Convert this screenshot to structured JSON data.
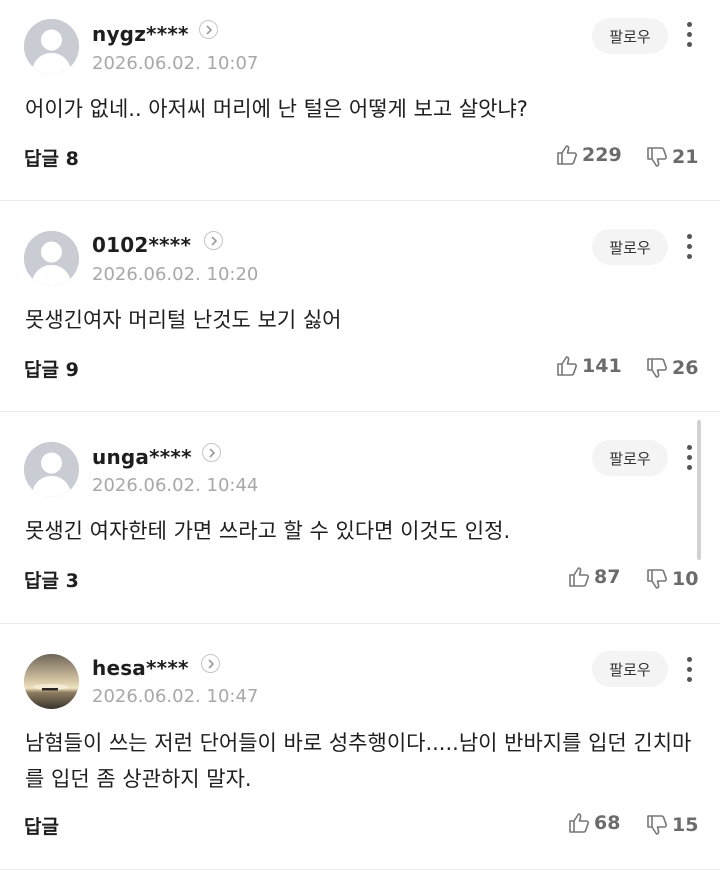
{
  "follow_label": "팔로우",
  "comments": [
    {
      "username": "nygz****",
      "timestamp": "2026.06.02. 10:07",
      "content": "어이가 없네.. 아저씨 머리에 난 털은 어떻게 보고 살앗냐?",
      "reply_label": "답글 8",
      "likes": "229",
      "dislikes": "21",
      "avatar": "default-avatar"
    },
    {
      "username": "0102****",
      "timestamp": "2026.06.02. 10:20",
      "content": "못생긴여자 머리털 난것도 보기 싫어",
      "reply_label": "답글 9",
      "likes": "141",
      "dislikes": "26",
      "avatar": "default-avatar"
    },
    {
      "username": "unga****",
      "timestamp": "2026.06.02. 10:44",
      "content": "못생긴 여자한테 가면 쓰라고 할 수 있다면 이것도 인정.",
      "reply_label": "답글 3",
      "likes": "87",
      "dislikes": "10",
      "avatar": "default-avatar"
    },
    {
      "username": "hesa****",
      "timestamp": "2026.06.02. 10:47",
      "content": "남혐들이 쓰는 저런 단어들이 바로 성추행이다.....남이 반바지를 입던 긴치마를 입던 좀 상관하지 말자.",
      "reply_label": "답글",
      "likes": "68",
      "dislikes": "15",
      "avatar": "sunset-photo-avatar"
    }
  ],
  "icons": {
    "like": "thumbs-up-icon",
    "dislike": "thumbs-down-icon",
    "more": "more-vertical-icon",
    "profile_link": "chevron-right-icon"
  },
  "colors": {
    "text": "#1f1f1f",
    "muted": "#a8a8a8",
    "count": "#6b6b6b",
    "follow_bg": "#f4f4f4",
    "avatar_default": "#c9ccd2"
  }
}
